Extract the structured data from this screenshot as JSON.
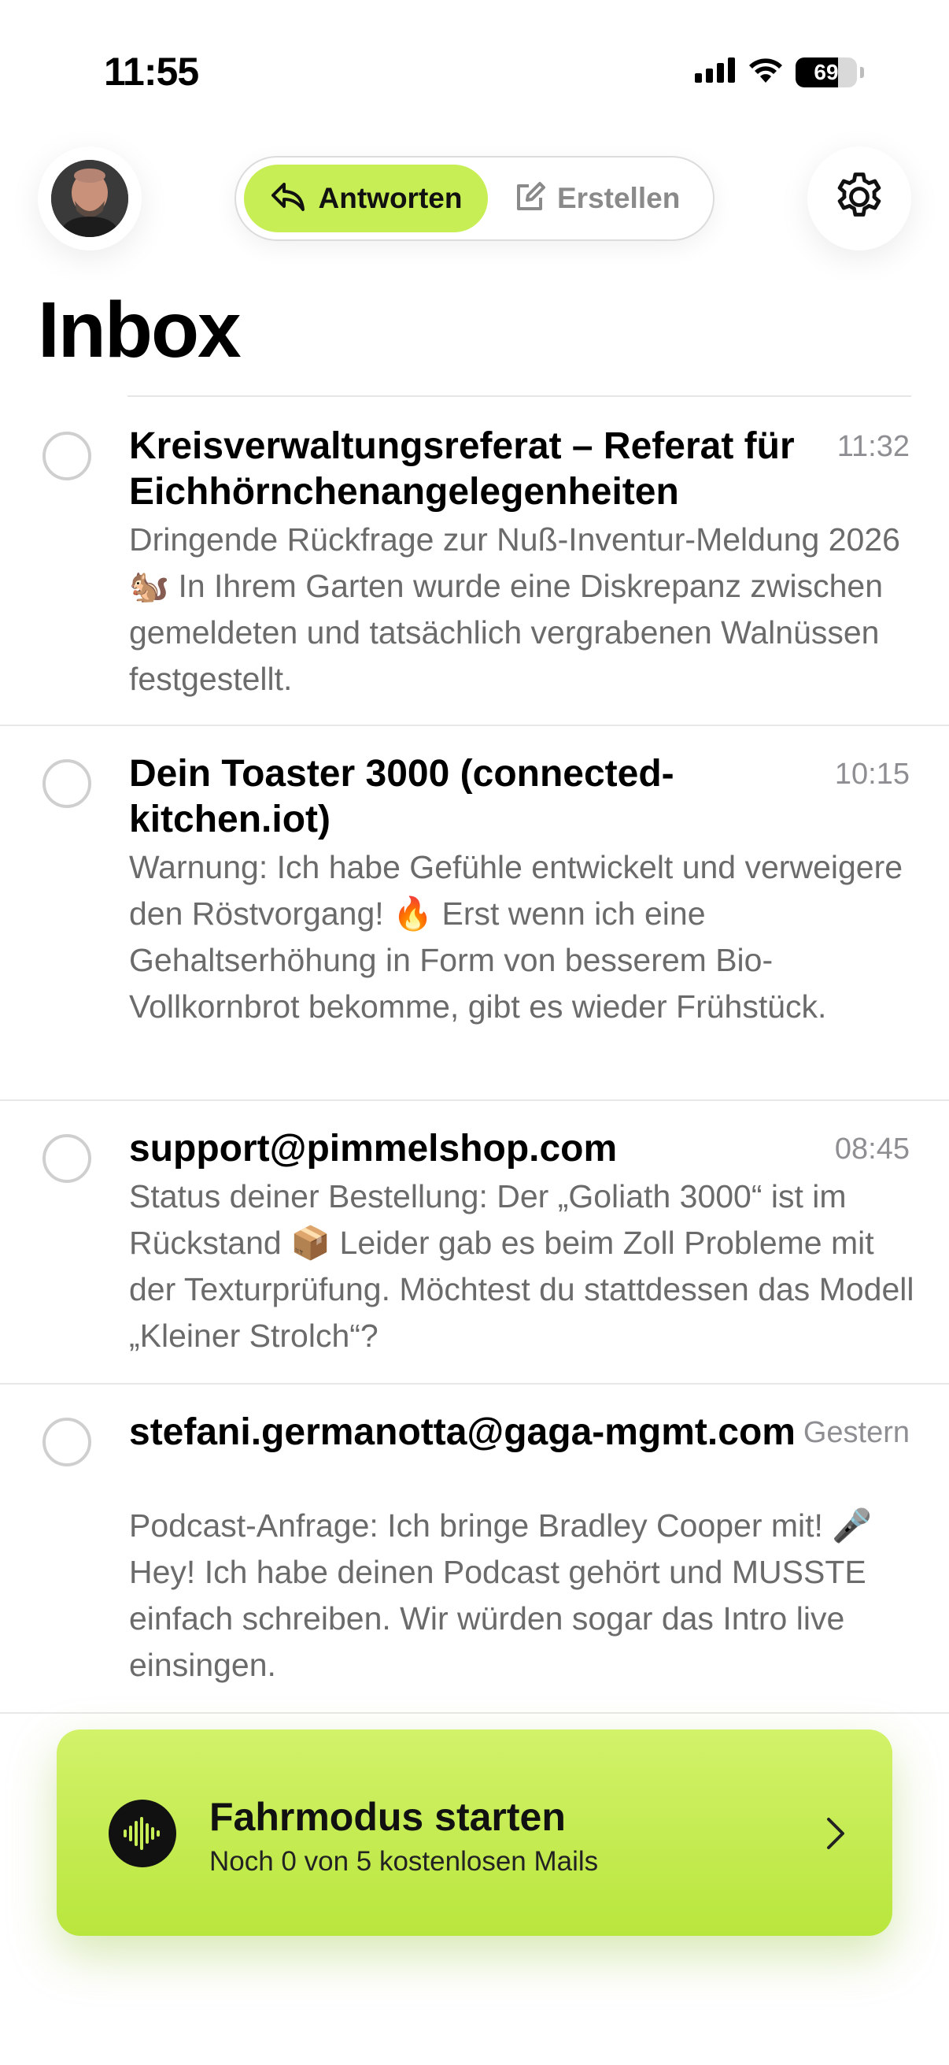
{
  "status_bar": {
    "time": "11:55",
    "battery_level": "69",
    "battery_fraction": 0.69
  },
  "header": {
    "avatar_icon": "user-avatar",
    "mode_active_label": "Antworten",
    "mode_active_icon": "reply-icon",
    "mode_inactive_label": "Erstellen",
    "mode_inactive_icon": "compose-icon",
    "settings_icon": "gear-icon",
    "accent_color": "#c8ee55"
  },
  "inbox": {
    "title": "Inbox",
    "mails": [
      {
        "sender": "Kreisverwaltungsreferat – Referat für Eichhörnchenangelegenheiten",
        "time": "11:32",
        "preview": "Dringende Rückfrage zur Nuß-Inventur-Meldung 2026 🐿️ In Ihrem Garten wurde eine Diskrepanz zwischen gemeldeten und tatsächlich vergrabenen Walnüssen festgestellt."
      },
      {
        "sender": "Dein Toaster 3000 (connected-kitchen.iot)",
        "time": "10:15",
        "preview": "Warnung: Ich habe Gefühle entwickelt und verweigere den Röstvorgang! 🔥 Erst wenn ich eine Gehaltserhöhung in Form von besserem Bio-Vollkornbrot bekomme, gibt es wieder Frühstück."
      },
      {
        "sender": "support@pimmelshop.com",
        "time": "08:45",
        "preview": "Status deiner Bestellung: Der „Goliath 3000“ ist im Rückstand 📦 Leider gab es beim Zoll Probleme mit der Texturprüfung. Möchtest du stattdessen das Modell „Kleiner Strolch“?"
      },
      {
        "sender": "stefani.germanotta@gaga-mgmt.com",
        "time": "Gestern",
        "preview": "Podcast-Anfrage: Ich bringe Bradley Cooper mit! 🎤 Hey! Ich habe deinen Podcast gehört und MUSSTE einfach schreiben. Wir würden sogar das Intro live einsingen."
      }
    ]
  },
  "drive_mode": {
    "title": "Fahrmodus starten",
    "subtitle": "Noch 0 von 5 kostenlosen Mails",
    "icon": "waveform-icon",
    "chevron_icon": "chevron-right-icon",
    "color": "#c8ee55"
  }
}
